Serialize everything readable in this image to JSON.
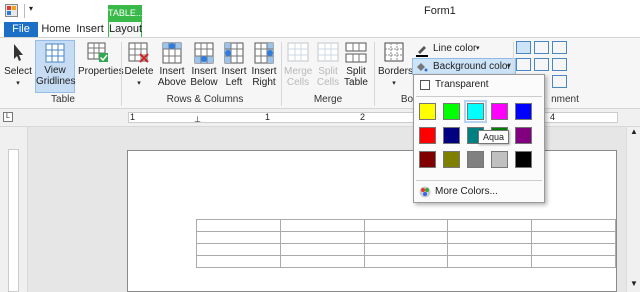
{
  "window": {
    "title": "Form1"
  },
  "tabs": [
    {
      "label": "File"
    },
    {
      "label": "Home"
    },
    {
      "label": "Insert"
    },
    {
      "label": "Layout"
    }
  ],
  "context_tab": {
    "label": "TABLE..."
  },
  "ribbon": {
    "table": {
      "select": "Select",
      "view_gridlines_1": "View",
      "view_gridlines_2": "Gridlines",
      "properties": "Properties",
      "group": "Table"
    },
    "rows_columns": {
      "delete": "Delete",
      "insert_above_1": "Insert",
      "insert_above_2": "Above",
      "insert_below_1": "Insert",
      "insert_below_2": "Below",
      "insert_left_1": "Insert",
      "insert_left_2": "Left",
      "insert_right_1": "Insert",
      "insert_right_2": "Right",
      "group": "Rows & Columns"
    },
    "merge": {
      "merge_cells_1": "Merge",
      "merge_cells_2": "Cells",
      "split_cells_1": "Split",
      "split_cells_2": "Cells",
      "split_table_1": "Split",
      "split_table_2": "Table",
      "group": "Merge"
    },
    "borders": {
      "borders": "Borders",
      "line_color": "Line color",
      "background_color": "Background color",
      "group": "Bo"
    },
    "alignment": {
      "group": "nment"
    }
  },
  "popup": {
    "transparent": "Transparent",
    "tooltip": "Aqua",
    "more_colors": "More Colors...",
    "colors": [
      [
        "#ffff00",
        "#00ff00",
        "#00ffff",
        "#ff00ff",
        "#0000ff"
      ],
      [
        "#ff0000",
        "#000080",
        "#008080",
        "#008000",
        "#800080"
      ],
      [
        "#800000",
        "#808000",
        "#808080",
        "#c0c0c0",
        "#000000"
      ]
    ],
    "selected": "#00ffff"
  },
  "ruler": {
    "marks": [
      "1",
      "1",
      "2",
      "3",
      "4"
    ]
  },
  "table": {
    "rows": 4,
    "cols": 5
  }
}
